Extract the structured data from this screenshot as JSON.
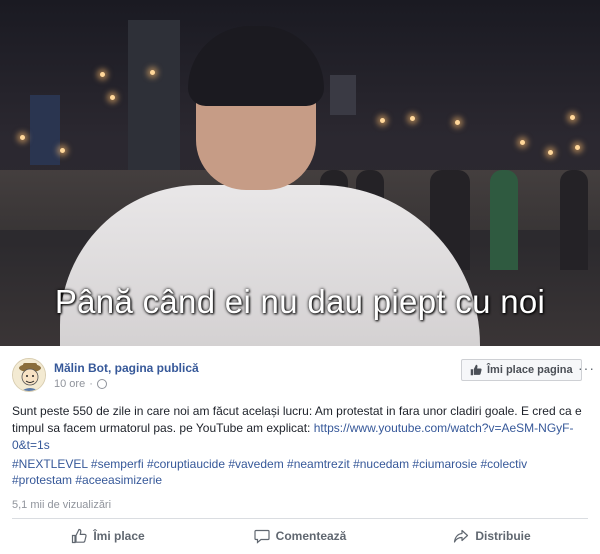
{
  "video": {
    "caption": "Până când ei nu dau piept cu noi"
  },
  "post": {
    "page_name": "Mălin Bot, pagina publică",
    "time": "10 ore",
    "separator": "·",
    "like_page_label": "Îmi place pagina",
    "more_label": "···",
    "text": "Sunt peste 550 de zile in care noi am făcut același lucru: Am protestat in fara unor cladiri goale. E cred ca e timpul sa facem urmatorul pas. pe YouTube am explicat:",
    "link": "https://www.youtube.com/watch?v=AeSM-NGyF-0&t=1s",
    "hashtags": "#NEXTLEVEL #semperfi #coruptiaucide #vavedem #neamtrezit #nucedam #ciumarosie #colectiv #protestam #aceeasimizerie",
    "views": "5,1 mii de vizualizări",
    "actions": {
      "like": "Îmi place",
      "comment": "Comentează",
      "share": "Distribuie"
    }
  },
  "icons": {
    "avatar": "cartoon-avatar",
    "globe": "globe-icon",
    "thumb": "thumbs-up-icon",
    "comment": "comment-icon",
    "share": "share-icon"
  },
  "colors": {
    "link": "#365899",
    "meta": "#90949c",
    "text": "#1d2129"
  }
}
